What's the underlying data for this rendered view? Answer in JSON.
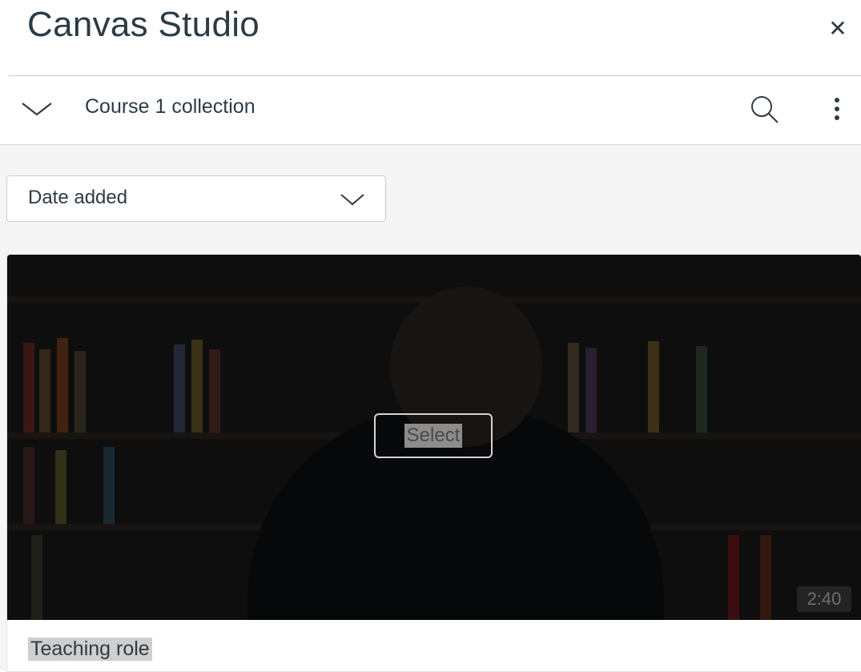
{
  "app": {
    "title": "Canvas Studio",
    "close_icon": "close-icon"
  },
  "collection": {
    "title": "Course 1 collection",
    "collapse_icon": "chevron-down-icon",
    "search_icon": "search-icon",
    "more_icon": "more-vertical-icon"
  },
  "sort": {
    "selected": "Date added",
    "chevron_icon": "chevron-down-icon"
  },
  "media": [
    {
      "title": "Teaching role",
      "duration": "2:40",
      "select_label": "Select"
    }
  ],
  "colors": {
    "text": "#2d3b45",
    "panel_background": "#f5f5f5",
    "border": "#c7cdd1"
  }
}
